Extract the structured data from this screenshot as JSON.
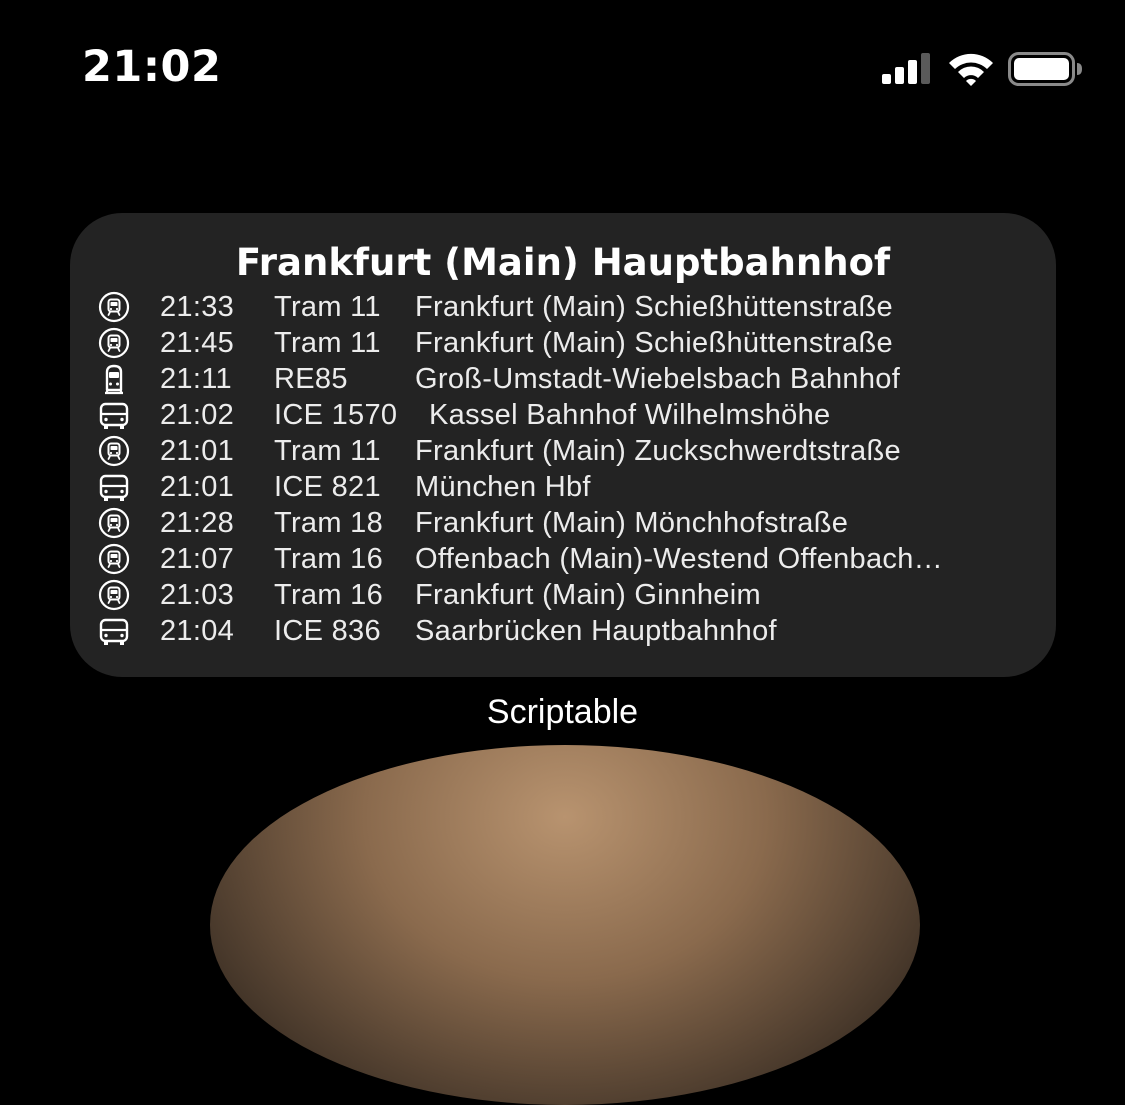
{
  "status_bar": {
    "time": "21:02",
    "icons": [
      "cellular-signal-icon",
      "wifi-icon",
      "battery-icon"
    ]
  },
  "widget": {
    "station": "Frankfurt (Main) Hauptbahnhof",
    "departures": [
      {
        "icon": "tram-icon",
        "time": "21:33",
        "line": "Tram 11",
        "destination": "Frankfurt (Main) Schießhüttenstraße"
      },
      {
        "icon": "tram-icon",
        "time": "21:45",
        "line": "Tram 11",
        "destination": "Frankfurt (Main) Schießhüttenstraße"
      },
      {
        "icon": "regional-train-icon",
        "time": "21:11",
        "line": "RE85",
        "destination": "Groß-Umstadt-Wiebelsbach Bahnhof"
      },
      {
        "icon": "intercity-train-icon",
        "time": "21:02",
        "line": "ICE 1570",
        "destination": "Kassel Bahnhof Wilhelmshöhe"
      },
      {
        "icon": "tram-icon",
        "time": "21:01",
        "line": "Tram 11",
        "destination": "Frankfurt (Main) Zuckschwerdtstraße"
      },
      {
        "icon": "intercity-train-icon",
        "time": "21:01",
        "line": "ICE 821",
        "destination": "München Hbf"
      },
      {
        "icon": "tram-icon",
        "time": "21:28",
        "line": "Tram 18",
        "destination": "Frankfurt (Main) Mönchhofstraße"
      },
      {
        "icon": "tram-icon",
        "time": "21:07",
        "line": "Tram 16",
        "destination": "Offenbach (Main)-Westend Offenbach…"
      },
      {
        "icon": "tram-icon",
        "time": "21:03",
        "line": "Tram 16",
        "destination": "Frankfurt (Main) Ginnheim"
      },
      {
        "icon": "intercity-train-icon",
        "time": "21:04",
        "line": "ICE 836",
        "destination": "Saarbrücken Hauptbahnhof"
      }
    ]
  },
  "app_label": "Scriptable",
  "colors": {
    "background": "#000000",
    "widget_background": "#232323",
    "text": "#ffffff"
  }
}
